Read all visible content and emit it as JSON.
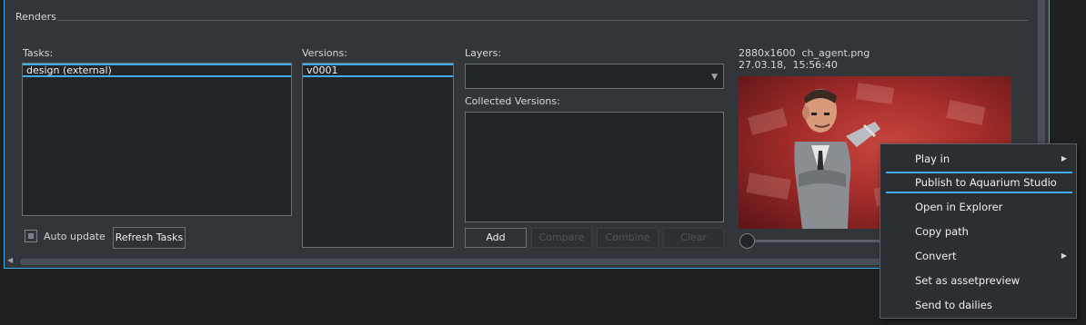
{
  "group": {
    "title": "Renders"
  },
  "tasks": {
    "label": "Tasks:",
    "items": [
      "design (external)"
    ]
  },
  "versions": {
    "label": "Versions:",
    "items": [
      "v0001"
    ]
  },
  "layers": {
    "label": "Layers:",
    "value": ""
  },
  "collected": {
    "label": "Collected Versions:"
  },
  "buttons": {
    "add": "Add",
    "compare": "Compare",
    "combine": "Combine",
    "clear": "Clear",
    "refresh": "Refresh Tasks"
  },
  "auto_update": {
    "label": "Auto update",
    "checked": false
  },
  "preview": {
    "resolution": "2880x1600",
    "filename": "ch_agent.png",
    "date": "27.03.18,",
    "time": "15:56:40"
  },
  "context_menu": {
    "items": [
      {
        "label": "Play in",
        "submenu": true
      },
      {
        "label": "Publish to Aquarium Studio",
        "highlighted": true
      },
      {
        "label": "Open in Explorer"
      },
      {
        "label": "Copy path"
      },
      {
        "label": "Convert",
        "submenu": true
      },
      {
        "label": "Set as assetpreview"
      },
      {
        "label": "Send to dailies"
      }
    ]
  },
  "colors": {
    "accent": "#3daee9",
    "panel": "#31363b",
    "list_bg": "#232629"
  }
}
